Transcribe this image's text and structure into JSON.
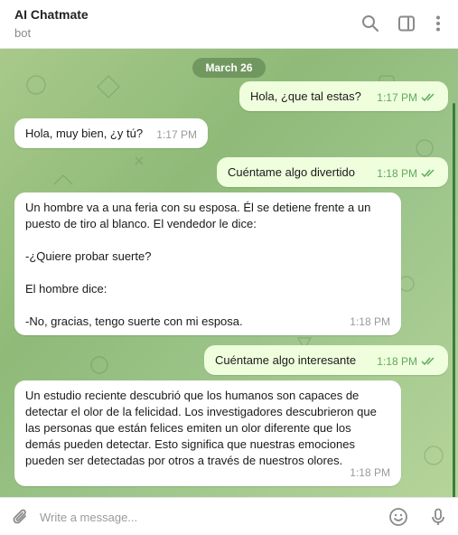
{
  "header": {
    "title": "AI Chatmate",
    "subtitle": "bot",
    "icons": [
      "search-icon",
      "sidebar-toggle-icon",
      "more-vertical-icon"
    ]
  },
  "chat": {
    "date_label": "March 26",
    "messages": [
      {
        "direction": "out",
        "text": "Hola, ¿que tal estas?",
        "time": "1:17 PM",
        "status": "read"
      },
      {
        "direction": "in",
        "text": "Hola, muy bien, ¿y tú?",
        "time": "1:17 PM"
      },
      {
        "direction": "out",
        "text": "Cuéntame algo divertido",
        "time": "1:18 PM",
        "status": "read"
      },
      {
        "direction": "in",
        "text": "Un hombre va a una feria con su esposa. Él se detiene frente a un\npuesto de tiro al blanco. El vendedor le dice:\n\n-¿Quiere probar suerte?\n\nEl hombre dice:\n\n-No, gracias, tengo suerte con mi esposa.",
        "time": "1:18 PM"
      },
      {
        "direction": "out",
        "text": "Cuéntame algo interesante",
        "time": "1:18 PM",
        "status": "read"
      },
      {
        "direction": "in",
        "text": "Un estudio reciente descubrió que los humanos son capaces de\ndetectar el olor de la felicidad. Los investigadores descubrieron que\nlas personas que están felices emiten un olor diferente que los\ndemás pueden detectar. Esto significa que nuestras emociones\npueden ser detectadas por otros a través de nuestros olores.",
        "time": "1:18 PM"
      }
    ]
  },
  "composer": {
    "placeholder": "Write a message...",
    "value": "",
    "icons": [
      "attach-icon",
      "emoji-icon",
      "microphone-icon"
    ]
  },
  "colors": {
    "outgoing_bubble": "#effedd",
    "incoming_bubble": "#ffffff",
    "read_check": "#5eaa5e",
    "chat_background": "#9cc48a",
    "date_pill": "#6b8f5e"
  }
}
